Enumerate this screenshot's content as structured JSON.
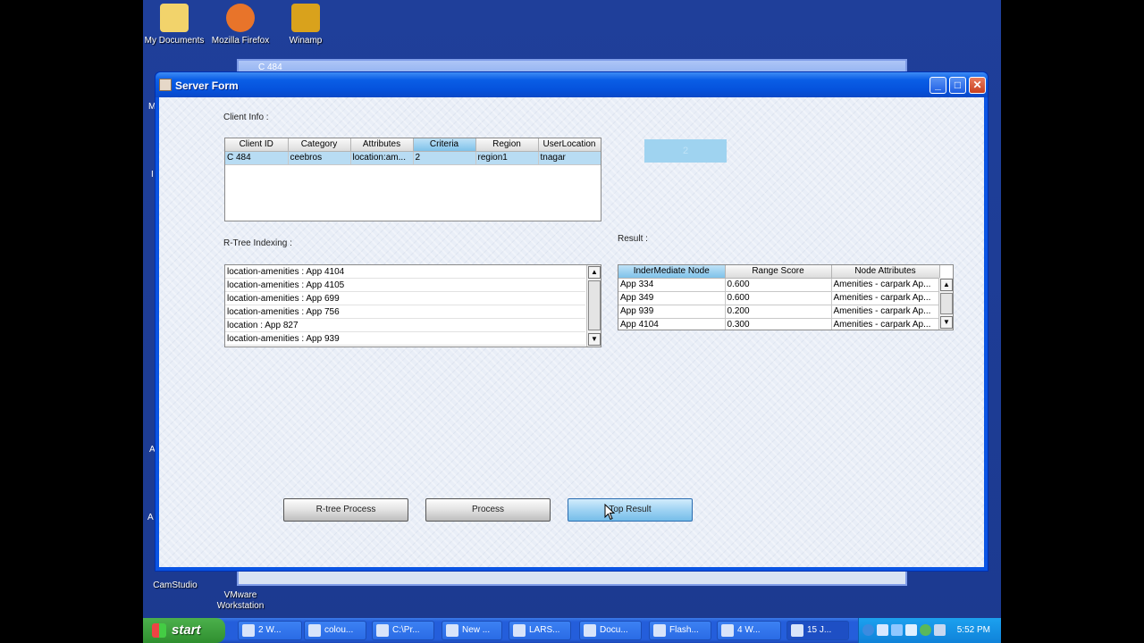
{
  "desktop": {
    "icons_top": [
      {
        "label": "My Documents",
        "color": "#f2d36b"
      },
      {
        "label": "Mozilla Firefox",
        "color": "#e8742a"
      },
      {
        "label": "Winamp",
        "color": "#d9a21c"
      }
    ],
    "icons_bottom": [
      {
        "label": "CamStudio"
      },
      {
        "label": "VMware\nWorkstation"
      }
    ],
    "edge_letters": [
      "M",
      "I",
      "A",
      "A"
    ]
  },
  "background_window": {
    "title": "C 484"
  },
  "window": {
    "title": "Server Form",
    "controls": {
      "minimize": "_",
      "maximize": "□",
      "close": "✕"
    }
  },
  "client_info": {
    "label": "Client Info :",
    "columns": [
      "Client ID",
      "Category",
      "Attributes",
      "Criteria",
      "Region",
      "UserLocation"
    ],
    "selected_column": "Criteria",
    "rows": [
      [
        "C 484",
        "ceebros",
        "location:am...",
        "2",
        "region1",
        "tnagar"
      ]
    ]
  },
  "status_box": {
    "text": "2"
  },
  "rtree": {
    "label": "R-Tree Indexing :",
    "items": [
      "location-amenities  :  App 4104",
      "location-amenities  :  App 4105",
      "location-amenities  :  App 699",
      "location-amenities  :  App 756",
      "location  :  App 827",
      "location-amenities  :  App 939"
    ]
  },
  "result": {
    "label": "Result :",
    "columns": [
      "InderMediate Node",
      "Range Score",
      "Node Attributes"
    ],
    "selected_column": "InderMediate Node",
    "rows": [
      [
        "App 334",
        "0.600",
        "Amenities - carpark Ap..."
      ],
      [
        "App 349",
        "0.600",
        "Amenities - carpark Ap..."
      ],
      [
        "App 939",
        "0.200",
        "Amenities - carpark Ap..."
      ],
      [
        "App 4104",
        "0.300",
        "Amenities - carpark Ap..."
      ]
    ]
  },
  "buttons": {
    "rtree_process": "R-tree Process",
    "process": "Process",
    "top_result": "Top Result"
  },
  "taskbar": {
    "start": "start",
    "items": [
      "2 W...",
      "colou...",
      "C:\\Pr...",
      "New ...",
      "LARS...",
      "Docu...",
      "Flash...",
      "4 W...",
      "15 J..."
    ],
    "clock": "5:52 PM"
  }
}
